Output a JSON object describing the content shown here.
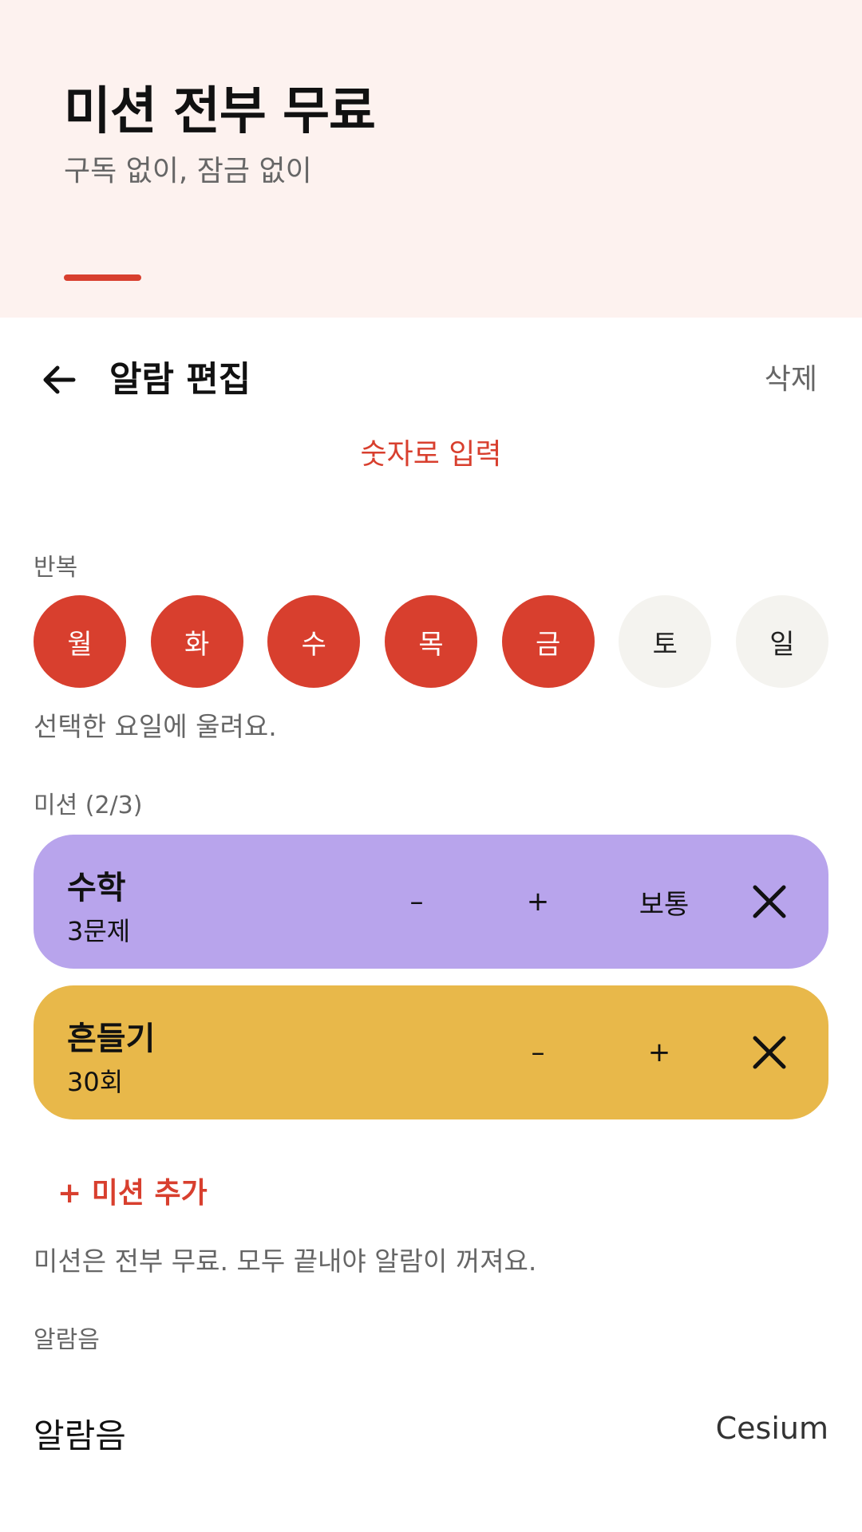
{
  "banner": {
    "title": "미션 전부 무료",
    "subtitle": "구독 없이, 잠금 없이"
  },
  "appbar": {
    "back_icon": "arrow-left-icon",
    "title": "알람 편집",
    "delete_label": "삭제"
  },
  "time_entry": {
    "numeric_input_label": "숫자로 입력"
  },
  "repeat": {
    "label": "반복",
    "days": [
      {
        "label": "월",
        "selected": true
      },
      {
        "label": "화",
        "selected": true
      },
      {
        "label": "수",
        "selected": true
      },
      {
        "label": "목",
        "selected": true
      },
      {
        "label": "금",
        "selected": true
      },
      {
        "label": "토",
        "selected": false
      },
      {
        "label": "일",
        "selected": false
      }
    ],
    "hint": "선택한 요일에 울려요."
  },
  "missions": {
    "label": "미션 (2/3)",
    "items": [
      {
        "name": "수학",
        "count": "3문제",
        "minus_label": "–",
        "plus_label": "+",
        "difficulty": "보통",
        "color": "#b8a4ec",
        "remove_icon": "close-icon"
      },
      {
        "name": "흔들기",
        "count": "30회",
        "minus_label": "–",
        "plus_label": "+",
        "color": "#e8b84a",
        "remove_icon": "close-icon"
      }
    ],
    "add_label": "+ 미션 추가",
    "note": "미션은 전부 무료. 모두 끝내야 알람이 꺼져요."
  },
  "sound": {
    "section_label": "알람음",
    "row_label": "알람음",
    "row_value": "Cesium"
  },
  "colors": {
    "accent": "#d83f2e",
    "banner_bg": "#fdf2ef",
    "day_off_bg": "#f4f3ef"
  }
}
